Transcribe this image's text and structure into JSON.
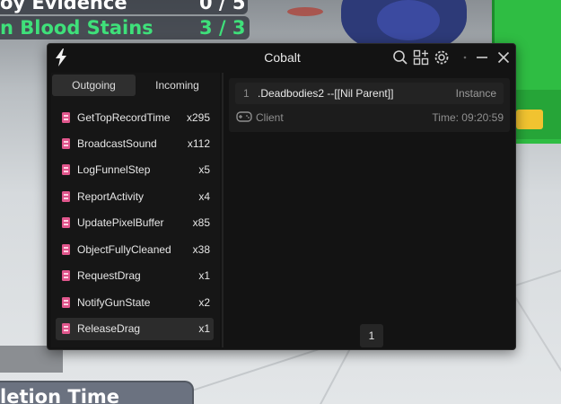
{
  "hud": {
    "evidence_label": "oy Evidence",
    "evidence_count": "0 / 5",
    "blood_label": "n Blood Stains",
    "blood_count": "3 / 3",
    "completion_label": "letion Time"
  },
  "window": {
    "title": "Cobalt"
  },
  "tabs": {
    "outgoing": "Outgoing",
    "incoming": "Incoming"
  },
  "remotes": [
    {
      "name": "GetTopRecordTime",
      "count": "x295"
    },
    {
      "name": "BroadcastSound",
      "count": "x112"
    },
    {
      "name": "LogFunnelStep",
      "count": "x5"
    },
    {
      "name": "ReportActivity",
      "count": "x4"
    },
    {
      "name": "UpdatePixelBuffer",
      "count": "x85"
    },
    {
      "name": "ObjectFullyCleaned",
      "count": "x38"
    },
    {
      "name": "RequestDrag",
      "count": "x1"
    },
    {
      "name": "NotifyGunState",
      "count": "x2"
    },
    {
      "name": "ReleaseDrag",
      "count": "x1"
    }
  ],
  "call": {
    "arg_index": "1",
    "arg_value": ".Deadbodies2 --[[Nil Parent]]",
    "arg_type": "Instance",
    "context": "Client",
    "time": "Time: 09:20:59"
  },
  "pagination": {
    "current": "1"
  },
  "colors": {
    "accent_green": "#3fe07a",
    "remote_icon": "#e0568c",
    "window_bg": "#131313"
  }
}
